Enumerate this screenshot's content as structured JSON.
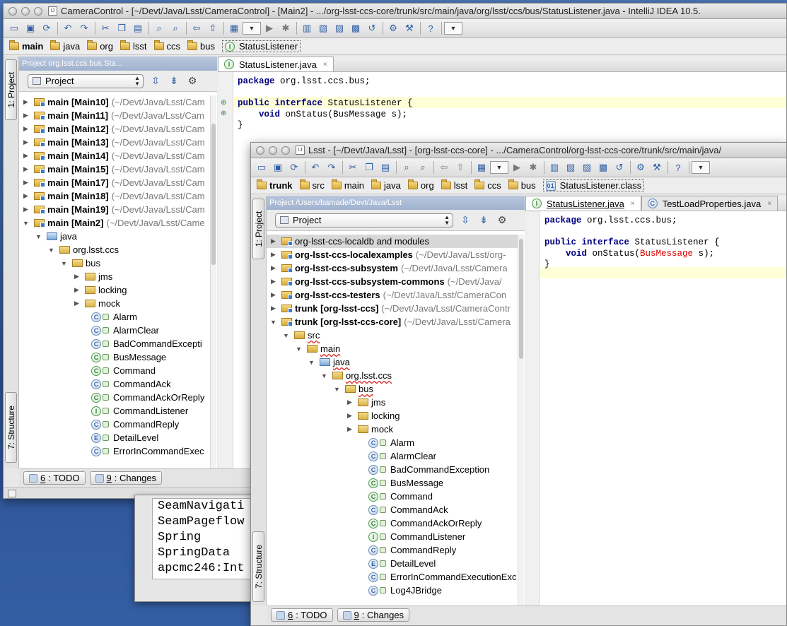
{
  "back_window": {
    "title": "CameraControl - [~/Devt/Java/Lsst/CameraControl] - [Main2] - .../org-lsst-ccs-core/trunk/src/main/java/org/lsst/ccs/bus/StatusListener.java - IntelliJ IDEA 10.5.",
    "breadcrumbs": [
      "main",
      "java",
      "org",
      "lsst",
      "ccs",
      "bus",
      "StatusListener"
    ],
    "panel_header": "Project org.lsst.ccs.bus.Sta...",
    "view_selector": "Project",
    "left_tabs": {
      "project": "1: Project",
      "structure": "7: Structure"
    },
    "tree": [
      {
        "name": "main [Main10]",
        "path": "(~/Devt/Java/Lsst/Cam"
      },
      {
        "name": "main [Main11]",
        "path": "(~/Devt/Java/Lsst/Cam"
      },
      {
        "name": "main [Main12]",
        "path": "(~/Devt/Java/Lsst/Cam"
      },
      {
        "name": "main [Main13]",
        "path": "(~/Devt/Java/Lsst/Cam"
      },
      {
        "name": "main [Main14]",
        "path": "(~/Devt/Java/Lsst/Cam"
      },
      {
        "name": "main [Main15]",
        "path": "(~/Devt/Java/Lsst/Cam"
      },
      {
        "name": "main [Main17]",
        "path": "(~/Devt/Java/Lsst/Cam"
      },
      {
        "name": "main [Main18]",
        "path": "(~/Devt/Java/Lsst/Cam"
      },
      {
        "name": "main [Main19]",
        "path": "(~/Devt/Java/Lsst/Cam"
      },
      {
        "name": "main [Main2]",
        "path": "(~/Devt/Java/Lsst/Came"
      },
      {
        "name": "java"
      },
      {
        "name": "org.lsst.ccs"
      },
      {
        "name": "bus"
      },
      {
        "name": "jms"
      },
      {
        "name": "locking"
      },
      {
        "name": "mock"
      },
      {
        "name": "Alarm"
      },
      {
        "name": "AlarmClear"
      },
      {
        "name": "BadCommandExcepti"
      },
      {
        "name": "BusMessage"
      },
      {
        "name": "Command"
      },
      {
        "name": "CommandAck"
      },
      {
        "name": "CommandAckOrReply"
      },
      {
        "name": "CommandListener"
      },
      {
        "name": "CommandReply"
      },
      {
        "name": "DetailLevel"
      },
      {
        "name": "ErrorInCommandExec"
      }
    ],
    "tab": "StatusListener.java",
    "code": [
      "package org.lsst.ccs.bus;",
      "",
      "public interface StatusListener {",
      "    void onStatus(BusMessage s);",
      "}"
    ],
    "bottom_tabs": [
      {
        "num": "6",
        "label": ": TODO"
      },
      {
        "num": "9",
        "label": ": Changes"
      }
    ]
  },
  "terminal_window": {
    "lines": [
      "SeamNavigati",
      "SeamPageflow",
      "Spring",
      "SpringData",
      "apcmc246:Int"
    ]
  },
  "front_window": {
    "title": "Lsst - [~/Devt/Java/Lsst] - [org-lsst-ccs-core] - .../CameraControl/org-lsst-ccs-core/trunk/src/main/java/",
    "breadcrumbs": [
      "trunk",
      "src",
      "main",
      "java",
      "org",
      "lsst",
      "ccs",
      "bus",
      "StatusListener.class"
    ],
    "panel_header": "Project /Users/bamade/Devt/Java/Lsst",
    "view_selector": "Project",
    "left_tabs": {
      "project": "1: Project",
      "structure": "7: Structure"
    },
    "tree": [
      {
        "name": "org-lsst-ccs-localdb and modules",
        "path": ""
      },
      {
        "name": "org-lsst-ccs-localexamples",
        "path": "(~/Devt/Java/Lsst/org-"
      },
      {
        "name": "org-lsst-ccs-subsystem",
        "path": "(~/Devt/Java/Lsst/Camera"
      },
      {
        "name": "org-lsst-ccs-subsystem-commons",
        "path": "(~/Devt/Java/"
      },
      {
        "name": "org-lsst-ccs-testers",
        "path": "(~/Devt/Java/Lsst/CameraCon"
      },
      {
        "name": "trunk [org-lsst-ccs]",
        "path": "(~/Devt/Java/Lsst/CameraContr"
      },
      {
        "name": "trunk [org-lsst-ccs-core]",
        "path": "(~/Devt/Java/Lsst/Camera"
      },
      {
        "name": "src"
      },
      {
        "name": "main"
      },
      {
        "name": "java"
      },
      {
        "name": "org.lsst.ccs"
      },
      {
        "name": "bus"
      },
      {
        "name": "jms"
      },
      {
        "name": "locking"
      },
      {
        "name": "mock"
      },
      {
        "name": "Alarm"
      },
      {
        "name": "AlarmClear"
      },
      {
        "name": "BadCommandException"
      },
      {
        "name": "BusMessage"
      },
      {
        "name": "Command"
      },
      {
        "name": "CommandAck"
      },
      {
        "name": "CommandAckOrReply"
      },
      {
        "name": "CommandListener"
      },
      {
        "name": "CommandReply"
      },
      {
        "name": "DetailLevel"
      },
      {
        "name": "ErrorInCommandExecutionExc"
      },
      {
        "name": "Log4JBridge"
      }
    ],
    "tabs": [
      "StatusListener.java",
      "TestLoadProperties.java"
    ],
    "code": [
      "package org.lsst.ccs.bus;",
      "",
      "public interface StatusListener {",
      "    void onStatus(BusMessage s);",
      "}"
    ],
    "bottom_tabs": [
      {
        "num": "6",
        "label": ": TODO"
      },
      {
        "num": "9",
        "label": ": Changes"
      }
    ]
  },
  "icons": {
    "app": "intellij-app-icon",
    "toolbar": [
      "open-icon",
      "save-icon",
      "sync-icon",
      "undo-icon",
      "redo-icon",
      "cut-icon",
      "copy-icon",
      "paste-icon",
      "find-icon",
      "replace-icon",
      "back-icon",
      "forward-icon",
      "build-icon",
      "run-icon",
      "debug-icon",
      "settings-icon",
      "help-icon"
    ]
  }
}
